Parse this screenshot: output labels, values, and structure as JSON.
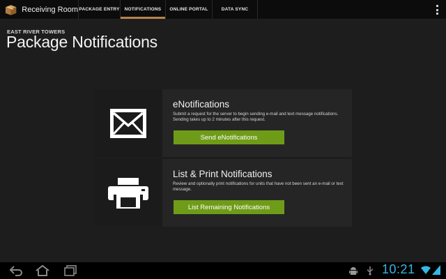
{
  "app": {
    "title": "Receiving Room",
    "icon": "package-box-icon"
  },
  "tabs": [
    {
      "label": "PACKAGE ENTRY",
      "active": false
    },
    {
      "label": "NOTIFICATIONS",
      "active": true
    },
    {
      "label": "ONLINE PORTAL",
      "active": false
    },
    {
      "label": "DATA SYNC",
      "active": false
    }
  ],
  "header": {
    "org": "EAST RIVER TOWERS",
    "title": "Package Notifications"
  },
  "cards": [
    {
      "icon": "envelope-icon",
      "title": "eNotifications",
      "description": "Submit a request for the server to begin sending e-mail and text message notifications.  Sending takes up to 2 minutes after this request.",
      "button": "Send eNotifications"
    },
    {
      "icon": "printer-icon",
      "title": "List & Print Notifications",
      "description": "Review and optionally print notifications for units that have not been sent an e-mail or text message.",
      "button": "List Remaining Notifications"
    }
  ],
  "system_bar": {
    "time": "10:21"
  },
  "colors": {
    "accent_button": "#6f9c18",
    "tab_indicator": "#b8834b",
    "clock": "#36b6e6"
  }
}
